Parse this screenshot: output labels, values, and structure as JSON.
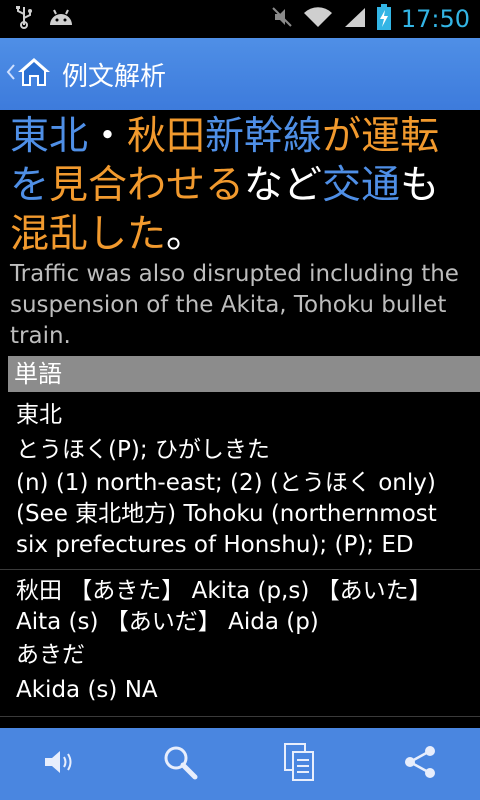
{
  "status_bar": {
    "clock": "17:50",
    "icons": [
      "usb-icon",
      "android-icon",
      "mute-icon",
      "wifi-icon",
      "cell-signal-icon",
      "battery-charging-icon"
    ]
  },
  "action_bar": {
    "title": "例文解析",
    "icon": "home-icon"
  },
  "sentence": {
    "segments": [
      {
        "text": "東北",
        "color": "blue"
      },
      {
        "text": "・",
        "color": "white"
      },
      {
        "text": "秋田",
        "color": "orange"
      },
      {
        "text": "新幹線",
        "color": "blue"
      },
      {
        "text": "が",
        "color": "orange"
      },
      {
        "text": "運転",
        "color": "orange"
      },
      {
        "text": "を",
        "color": "blue"
      },
      {
        "text": "見合わせる",
        "color": "orange"
      },
      {
        "text": "など",
        "color": "white"
      },
      {
        "text": "交通",
        "color": "blue"
      },
      {
        "text": "も",
        "color": "white"
      },
      {
        "text": "混乱",
        "color": "orange"
      },
      {
        "text": "した",
        "color": "orange"
      },
      {
        "text": "。",
        "color": "white"
      }
    ],
    "translation": "Traffic was also disrupted including the suspension of the Akita, Tohoku bullet train."
  },
  "section_header": "単語",
  "entries": [
    {
      "word": "東北",
      "reading": "とうほく(P); ひがしきた",
      "gloss": "(n) (1) north-east; (2) (とうほく only) (See 東北地方) Tohoku (northernmost six prefectures of Honshu); (P); ED"
    },
    {
      "word": "秋田 【あきた】 Akita (p,s) 【あいた】 Aita (s) 【あいだ】 Aida (p)",
      "reading": "あきだ",
      "gloss": "Akida (s) NA"
    }
  ],
  "bottom_bar": {
    "buttons": [
      "speaker-icon",
      "search-icon",
      "copy-icon",
      "share-icon"
    ]
  },
  "colors": {
    "accent_blue": "#4f8fe6",
    "orange": "#f29a2e",
    "clock_blue": "#33b5e5",
    "header_gray": "#8c8c8c"
  }
}
